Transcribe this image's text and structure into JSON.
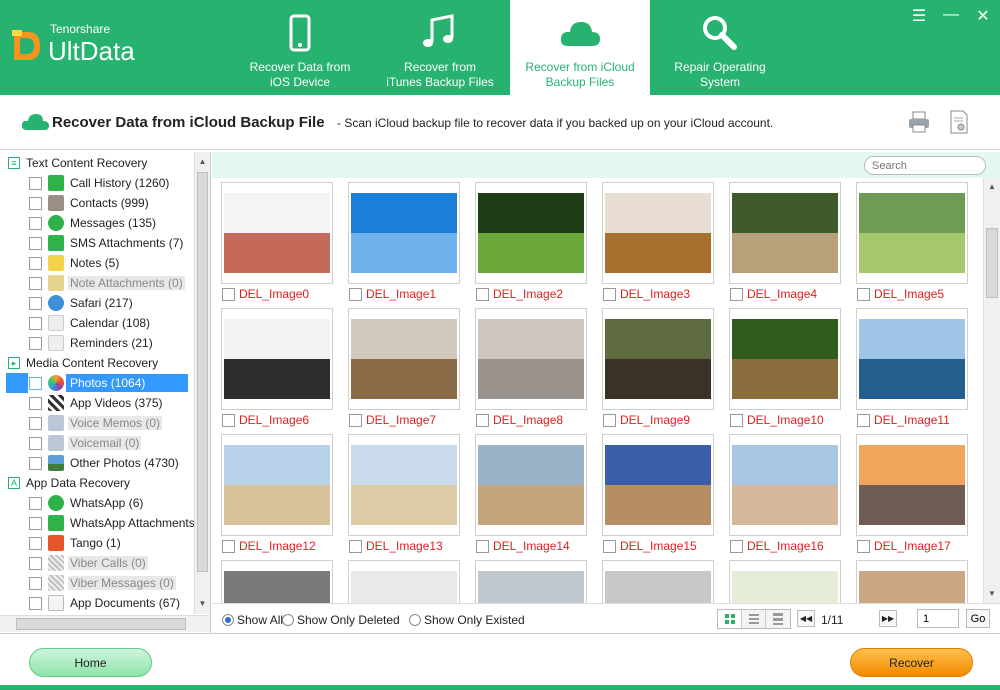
{
  "app": {
    "brand_small": "Tenorshare",
    "brand_big": "UltData",
    "accent": "#27b36f"
  },
  "nav": [
    {
      "label": "Recover Data from iOS Device",
      "icon": "phone-icon"
    },
    {
      "label": "Recover from iTunes Backup Files",
      "icon": "music-note-icon"
    },
    {
      "label": "Recover from iCloud Backup Files",
      "icon": "cloud-icon",
      "active": true
    },
    {
      "label": "Repair Operating System",
      "icon": "wrench-icon"
    }
  ],
  "window_controls": [
    "menu-icon",
    "minimize-icon",
    "close-icon"
  ],
  "title": {
    "heading": "Recover Data from iCloud Backup File",
    "description": "- Scan iCloud backup file to recover data if you backed up on your iCloud account."
  },
  "sidebar": {
    "categories": [
      {
        "label": "Text Content Recovery",
        "items": [
          {
            "label": "Call History (1260)",
            "icon": "phone-icon",
            "color": "#2db34a"
          },
          {
            "label": "Contacts (999)",
            "icon": "contact-icon",
            "color": "#9a8f84"
          },
          {
            "label": "Messages (135)",
            "icon": "message-icon",
            "color": "#2db34a"
          },
          {
            "label": "SMS Attachments (7)",
            "icon": "paperclip-icon",
            "color": "#2db34a"
          },
          {
            "label": "Notes (5)",
            "icon": "notes-icon",
            "color": "#f2d34a"
          },
          {
            "label": "Note Attachments (0)",
            "icon": "note-attachment-icon",
            "color": "#e5d38e",
            "disabled": true
          },
          {
            "label": "Safari (217)",
            "icon": "safari-icon",
            "color": "#3f8fd9"
          },
          {
            "label": "Calendar (108)",
            "icon": "calendar-icon",
            "color": "#d9d9d9"
          },
          {
            "label": "Reminders (21)",
            "icon": "reminders-icon",
            "color": "#d9d9d9"
          }
        ]
      },
      {
        "label": "Media Content Recovery",
        "items": [
          {
            "label": "Photos (1064)",
            "icon": "photos-icon",
            "color": "#f0a030",
            "selected": true
          },
          {
            "label": "App Videos (375)",
            "icon": "clapper-icon",
            "color": "#333333"
          },
          {
            "label": "Voice Memos (0)",
            "icon": "voice-memo-icon",
            "color": "#b9c7d6",
            "disabled": true
          },
          {
            "label": "Voicemail (0)",
            "icon": "voicemail-icon",
            "color": "#b9c7d6",
            "disabled": true
          },
          {
            "label": "Other Photos (4730)",
            "icon": "landscape-icon",
            "color": "#5a9fd8"
          }
        ]
      },
      {
        "label": "App Data Recovery",
        "items": [
          {
            "label": "WhatsApp (6)",
            "icon": "whatsapp-icon",
            "color": "#2db34a"
          },
          {
            "label": "WhatsApp Attachments (",
            "icon": "whatsapp-attachment-icon",
            "color": "#2db34a"
          },
          {
            "label": "Tango (1)",
            "icon": "tango-icon",
            "color": "#e8552a"
          },
          {
            "label": "Viber Calls (0)",
            "icon": "viber-calls-icon",
            "color": "#c0c0c0",
            "disabled": true
          },
          {
            "label": "Viber Messages (0)",
            "icon": "viber-messages-icon",
            "color": "#c0c0c0",
            "disabled": true
          },
          {
            "label": "App Documents (67)",
            "icon": "document-icon",
            "color": "#cccccc"
          }
        ]
      }
    ]
  },
  "search": {
    "placeholder": "Search"
  },
  "photos": [
    {
      "name": "DEL_Image0",
      "sky": "#f4f4f4",
      "ground": "#c56a5a"
    },
    {
      "name": "DEL_Image1",
      "sky": "#1e7fd8",
      "ground": "#6fb3ee"
    },
    {
      "name": "DEL_Image2",
      "sky": "#1f3d16",
      "ground": "#6aa83a"
    },
    {
      "name": "DEL_Image3",
      "sky": "#e7ddd0",
      "ground": "#a8702e"
    },
    {
      "name": "DEL_Image4",
      "sky": "#3f5a2a",
      "ground": "#b8a07a"
    },
    {
      "name": "DEL_Image5",
      "sky": "#6e9c54",
      "ground": "#a4c86b"
    },
    {
      "name": "DEL_Image6",
      "sky": "#f2f2f2",
      "ground": "#2d2d2d"
    },
    {
      "name": "DEL_Image7",
      "sky": "#d0c8bc",
      "ground": "#8b6a47"
    },
    {
      "name": "DEL_Image8",
      "sky": "#cfc7bf",
      "ground": "#9b948e"
    },
    {
      "name": "DEL_Image9",
      "sky": "#5e6b3f",
      "ground": "#3a3226"
    },
    {
      "name": "DEL_Image10",
      "sky": "#2f5b1f",
      "ground": "#8a6e3e"
    },
    {
      "name": "DEL_Image11",
      "sky": "#9fc5e6",
      "ground": "#245e8e"
    },
    {
      "name": "DEL_Image12",
      "sky": "#b8d2ea",
      "ground": "#d8c29a"
    },
    {
      "name": "DEL_Image13",
      "sky": "#c9dbea",
      "ground": "#dccca6"
    },
    {
      "name": "DEL_Image14",
      "sky": "#9ab3c8",
      "ground": "#c4a47a"
    },
    {
      "name": "DEL_Image15",
      "sky": "#3a5ea8",
      "ground": "#b68e63"
    },
    {
      "name": "DEL_Image16",
      "sky": "#a8c6e4",
      "ground": "#d3b99a"
    },
    {
      "name": "DEL_Image17",
      "sky": "#f0a65a",
      "ground": "#6e5c55"
    },
    {
      "name": "",
      "sky": "#7a7a7a",
      "ground": "#6b8a9c"
    },
    {
      "name": "",
      "sky": "#e9e9e9",
      "ground": "#a6a6a6"
    },
    {
      "name": "",
      "sky": "#bfc8cf",
      "ground": "#5e6e78"
    },
    {
      "name": "",
      "sky": "#c8c8c8",
      "ground": "#3e4650"
    },
    {
      "name": "",
      "sky": "#e5ecd7",
      "ground": "#6d8c4a"
    },
    {
      "name": "",
      "sky": "#caa682",
      "ground": "#4a3421"
    }
  ],
  "filters": {
    "show_all": "Show All",
    "show_deleted": "Show Only Deleted",
    "show_existed": "Show Only Existed"
  },
  "pagination": {
    "page": "1/11",
    "input_value": "1",
    "go": "Go"
  },
  "footer": {
    "home": "Home",
    "recover": "Recover"
  }
}
